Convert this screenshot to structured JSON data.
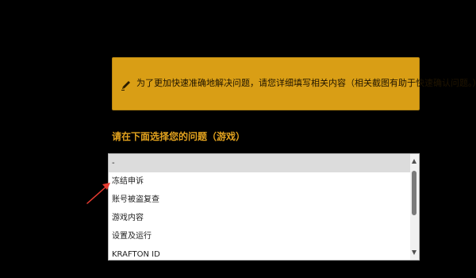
{
  "notice": {
    "icon": "pencil-icon",
    "text": "为了更加快速准确地解决问题，请您详细填写相关内容（相关截图有助于快速确认问题。）"
  },
  "category": {
    "label": "请在下面选择您的问题（游戏）",
    "options": [
      "-",
      "冻结申诉",
      "账号被盗复查",
      "游戏内容",
      "设置及运行",
      "KRAFTON ID"
    ],
    "selected_index": 0
  },
  "colors": {
    "notice_background": "#d99e15",
    "label_color": "#e2a21e",
    "annotation_arrow": "#e53b30"
  }
}
